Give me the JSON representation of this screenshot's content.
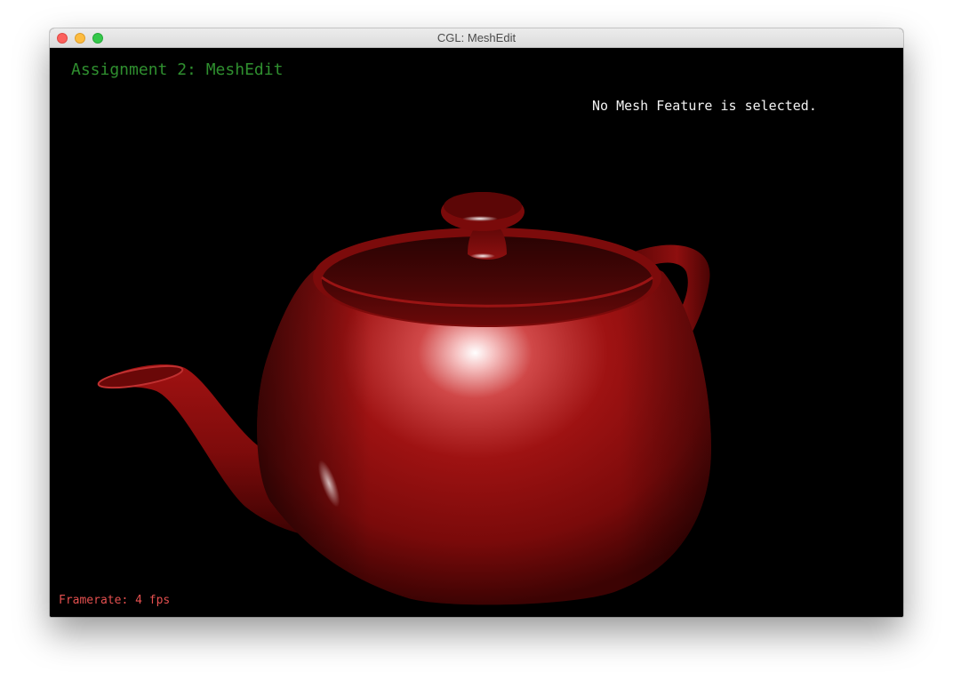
{
  "window": {
    "title": "CGL: MeshEdit"
  },
  "viewport": {
    "heading": "Assignment 2: MeshEdit",
    "selection_status": "No Mesh Feature is selected.",
    "framerate": "Framerate: 4 fps"
  },
  "colors": {
    "teapot": "#8a0d0d",
    "heading": "#2f8f2f",
    "framerate": "#e4504f",
    "status": "#f2f2f2",
    "background": "#000000"
  },
  "icons": {
    "close": "close-icon",
    "minimize": "minimize-icon",
    "maximize": "maximize-icon"
  }
}
